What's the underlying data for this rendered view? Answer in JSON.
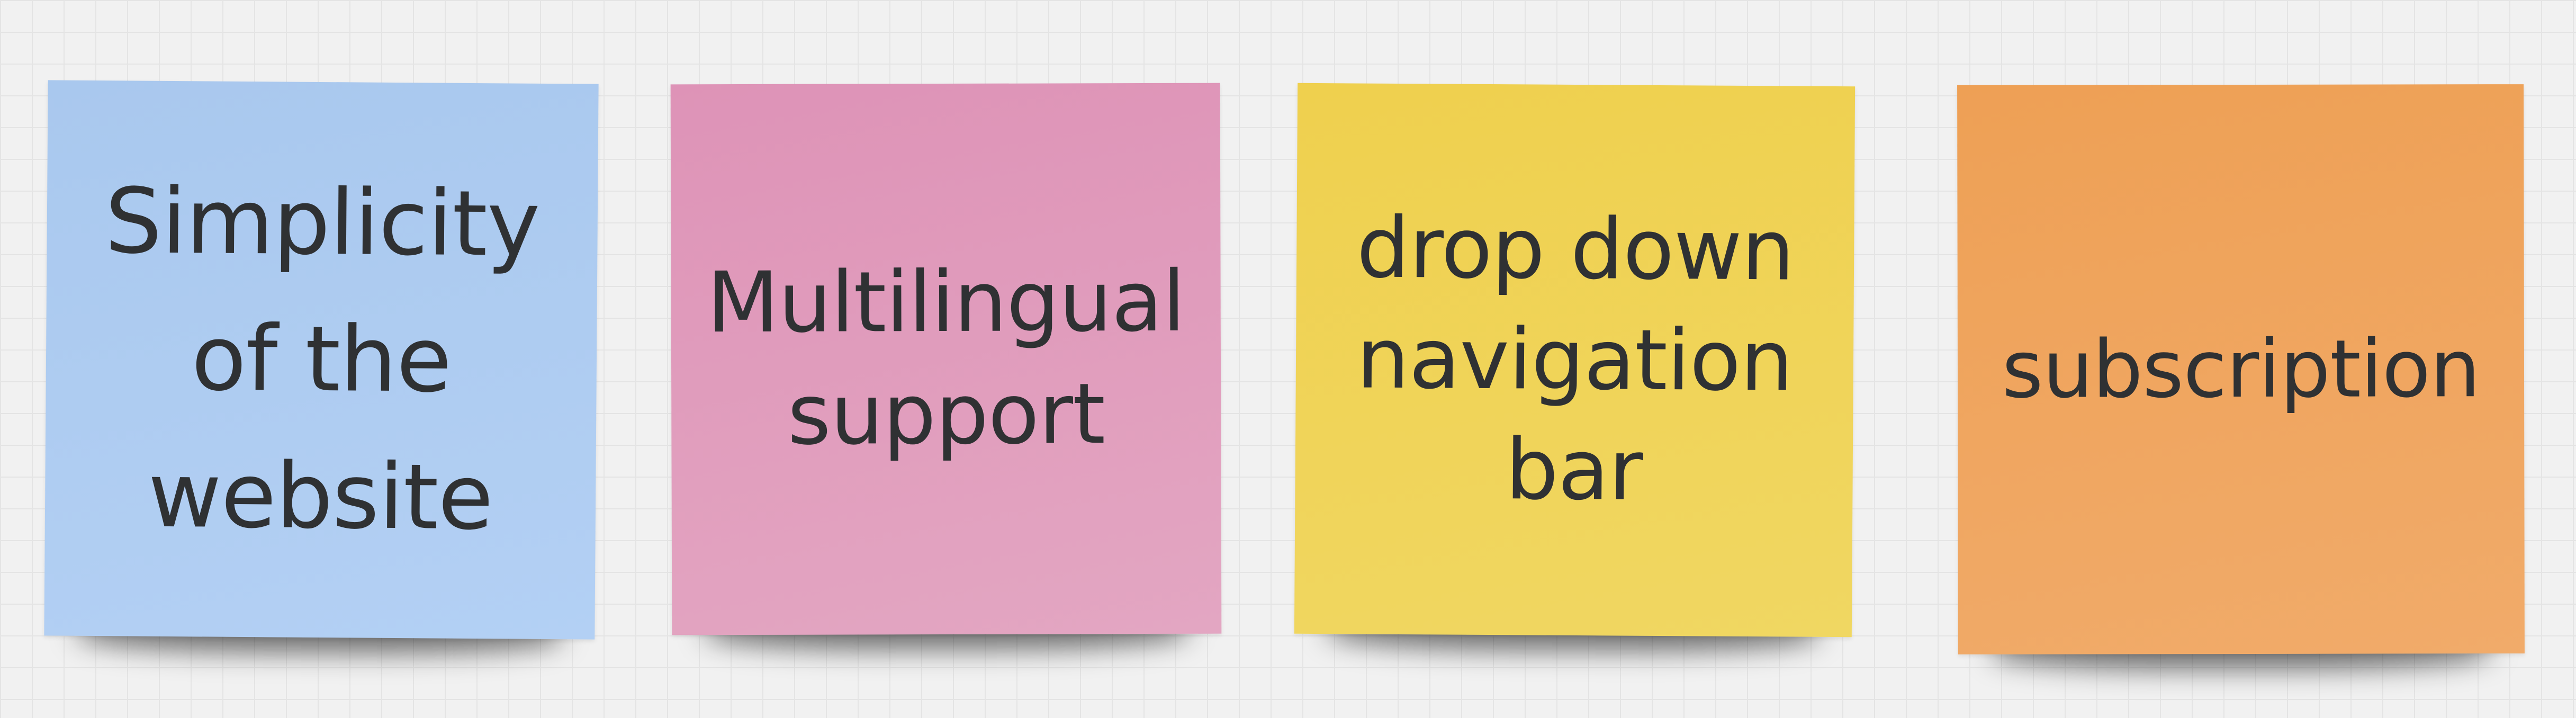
{
  "board": {
    "notes": [
      {
        "text": "Simplicity of the website",
        "lines": [
          "Simplicity",
          "of the",
          "website"
        ],
        "color": "#adcbf0"
      },
      {
        "text": "Multilingual support",
        "lines": [
          "Multilingual",
          "support"
        ],
        "color": "#e09bbc"
      },
      {
        "text": "drop down navigation bar",
        "lines": [
          "drop down",
          "navigation",
          "bar"
        ],
        "color": "#f0d355"
      },
      {
        "text": "subscription",
        "lines": [
          "subscription"
        ],
        "color": "#efa45e"
      }
    ]
  }
}
